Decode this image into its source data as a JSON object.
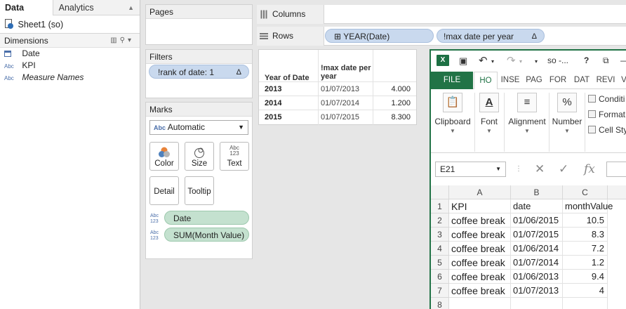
{
  "datapane": {
    "tab_data": "Data",
    "tab_analytics": "Analytics",
    "datasource": "Sheet1 (so)",
    "dimensions_label": "Dimensions",
    "fields": [
      {
        "type": "date",
        "name": "Date"
      },
      {
        "type": "Abc",
        "name": "KPI"
      },
      {
        "type": "Abc",
        "name": "Measure Names"
      }
    ]
  },
  "pages": {
    "title": "Pages"
  },
  "filters": {
    "title": "Filters",
    "pill": "!rank of date: 1",
    "pill_icon": "Δ"
  },
  "marks": {
    "title": "Marks",
    "type_prefix": "Abc",
    "type": "Automatic",
    "buttons": {
      "color": "Color",
      "size": "Size",
      "text": "Text",
      "detail": "Detail",
      "tooltip": "Tooltip"
    },
    "text_icon_top": "Abc",
    "text_icon_bottom": "123",
    "fields": [
      {
        "type_top": "Abc",
        "type_bottom": "123",
        "name": "Date"
      },
      {
        "type_top": "Abc",
        "type_bottom": "123",
        "name": "SUM(Month Value)"
      }
    ]
  },
  "shelves": {
    "columns_label": "Columns",
    "rows_label": "Rows",
    "rows_pills": [
      {
        "name": "YEAR(Date)",
        "prefix": "⊞"
      },
      {
        "name": "!max date per year",
        "suffix": "Δ"
      }
    ]
  },
  "crosstab": {
    "header_year": "Year of Date",
    "header_date_line1": "!max date per",
    "header_date_line2": "year",
    "rows": [
      {
        "year": "2013",
        "date": "01/07/2013",
        "value": "4.000"
      },
      {
        "year": "2014",
        "date": "01/07/2014",
        "value": "1.200"
      },
      {
        "year": "2015",
        "date": "01/07/2015",
        "value": "8.300"
      }
    ]
  },
  "excel": {
    "logo": "X",
    "title": "so -...",
    "title_icons": {
      "save": "💾",
      "undo": "↶",
      "redo": "↷",
      "help": "?",
      "restore": "⧉"
    },
    "tabs": [
      "FILE",
      "HO",
      "INSE",
      "PAG",
      "FOR",
      "DAT",
      "REVI",
      "V"
    ],
    "ribbon": {
      "clipboard": "Clipboard",
      "font": "Font",
      "alignment": "Alignment",
      "number": "Number",
      "styles": [
        "Conditi",
        "Format",
        "Cell Sty"
      ]
    },
    "name_box": "E21",
    "fx": "fx",
    "columns": [
      "A",
      "B",
      "C"
    ],
    "rows": [
      {
        "n": "1",
        "a": "KPI",
        "b": "date",
        "c": "monthValue"
      },
      {
        "n": "2",
        "a": "coffee break",
        "b": "01/06/2015",
        "c": "10.5"
      },
      {
        "n": "3",
        "a": "coffee break",
        "b": "01/07/2015",
        "c": "8.3"
      },
      {
        "n": "4",
        "a": "coffee break",
        "b": "01/06/2014",
        "c": "7.2"
      },
      {
        "n": "5",
        "a": "coffee break",
        "b": "01/07/2014",
        "c": "1.2"
      },
      {
        "n": "6",
        "a": "coffee break",
        "b": "01/06/2013",
        "c": "9.4"
      },
      {
        "n": "7",
        "a": "coffee break",
        "b": "01/07/2013",
        "c": "4"
      },
      {
        "n": "8",
        "a": "",
        "b": "",
        "c": ""
      }
    ]
  }
}
